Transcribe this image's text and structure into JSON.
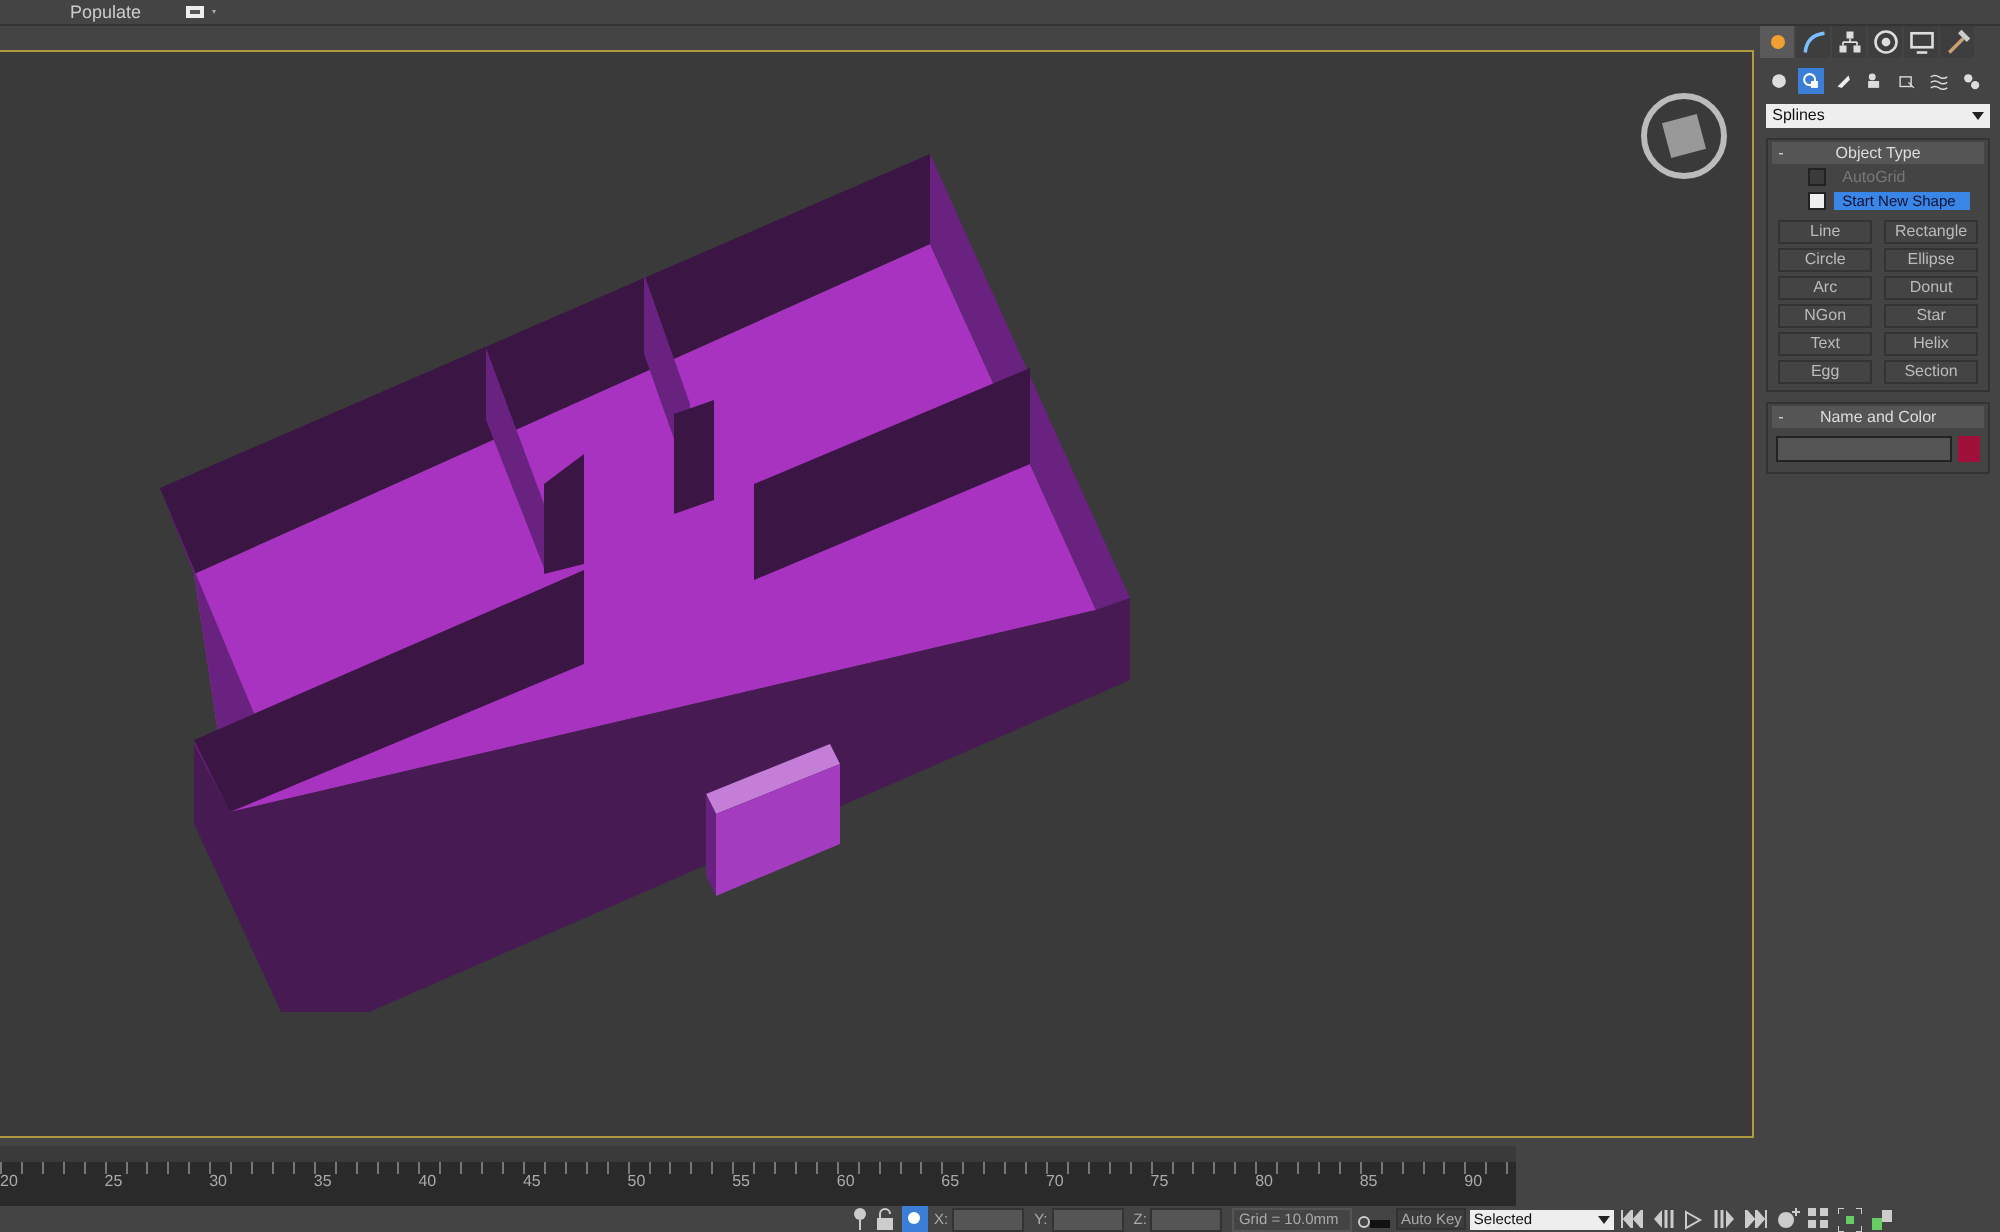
{
  "toolbar": {
    "items": [
      {
        "label": "Populate"
      }
    ]
  },
  "command_panel": {
    "tabs": [
      {
        "selected": true
      },
      {
        "selected": false
      },
      {
        "selected": false
      },
      {
        "selected": false
      },
      {
        "selected": false
      },
      {
        "selected": false
      }
    ],
    "subcategories": [
      {
        "selected": false
      },
      {
        "selected": true
      },
      {
        "selected": false
      },
      {
        "selected": false
      },
      {
        "selected": false
      },
      {
        "selected": false
      },
      {
        "selected": false
      }
    ],
    "category": "Splines",
    "object_type": {
      "title": "Object Type",
      "collapse": "-",
      "autogrid": {
        "label": "AutoGrid",
        "checked": false
      },
      "start_new_shape": {
        "label": "Start New Shape",
        "checked": true
      },
      "buttons": [
        "Line",
        "Rectangle",
        "Circle",
        "Ellipse",
        "Arc",
        "Donut",
        "NGon",
        "Star",
        "Text",
        "Helix",
        "Egg",
        "Section"
      ]
    },
    "name_and_color": {
      "title": "Name and Color",
      "collapse": "-",
      "color": "#a0103a"
    }
  },
  "timeline": {
    "ticks": [
      "20",
      "25",
      "30",
      "35",
      "40",
      "45",
      "50",
      "55",
      "60",
      "65",
      "70",
      "75",
      "80",
      "85",
      "90"
    ]
  },
  "status_bar": {
    "x_label": "X:",
    "y_label": "Y:",
    "z_label": "Z:",
    "grid": "Grid = 10.0mm",
    "auto_key": "Auto Key",
    "key_filter": "Selected"
  }
}
